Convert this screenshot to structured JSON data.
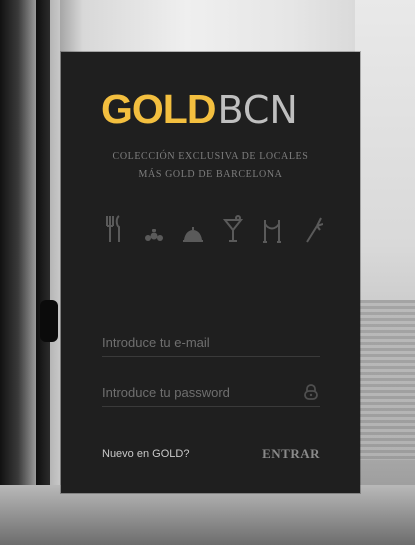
{
  "brand": {
    "logo_part1": "GOLD",
    "logo_part2": "BCN",
    "accent": "#f3bf3f"
  },
  "tagline": {
    "line1": "COLECCIÓN EXCLUSIVA DE LOCALES",
    "line2": "MÁS GOLD DE BARCELONA"
  },
  "categories": [
    {
      "icon": "cutlery-icon"
    },
    {
      "icon": "tapas-icon"
    },
    {
      "icon": "cloche-icon"
    },
    {
      "icon": "cocktail-icon"
    },
    {
      "icon": "velvet-rope-icon"
    },
    {
      "icon": "bird-of-paradise-icon"
    }
  ],
  "form": {
    "email_placeholder": "Introduce tu e-mail",
    "email_value": "",
    "password_placeholder": "Introduce tu password",
    "password_value": "",
    "password_icon": "lock-icon"
  },
  "footer": {
    "signup_link": "Nuevo en GOLD?",
    "submit_label": "ENTRAR"
  }
}
